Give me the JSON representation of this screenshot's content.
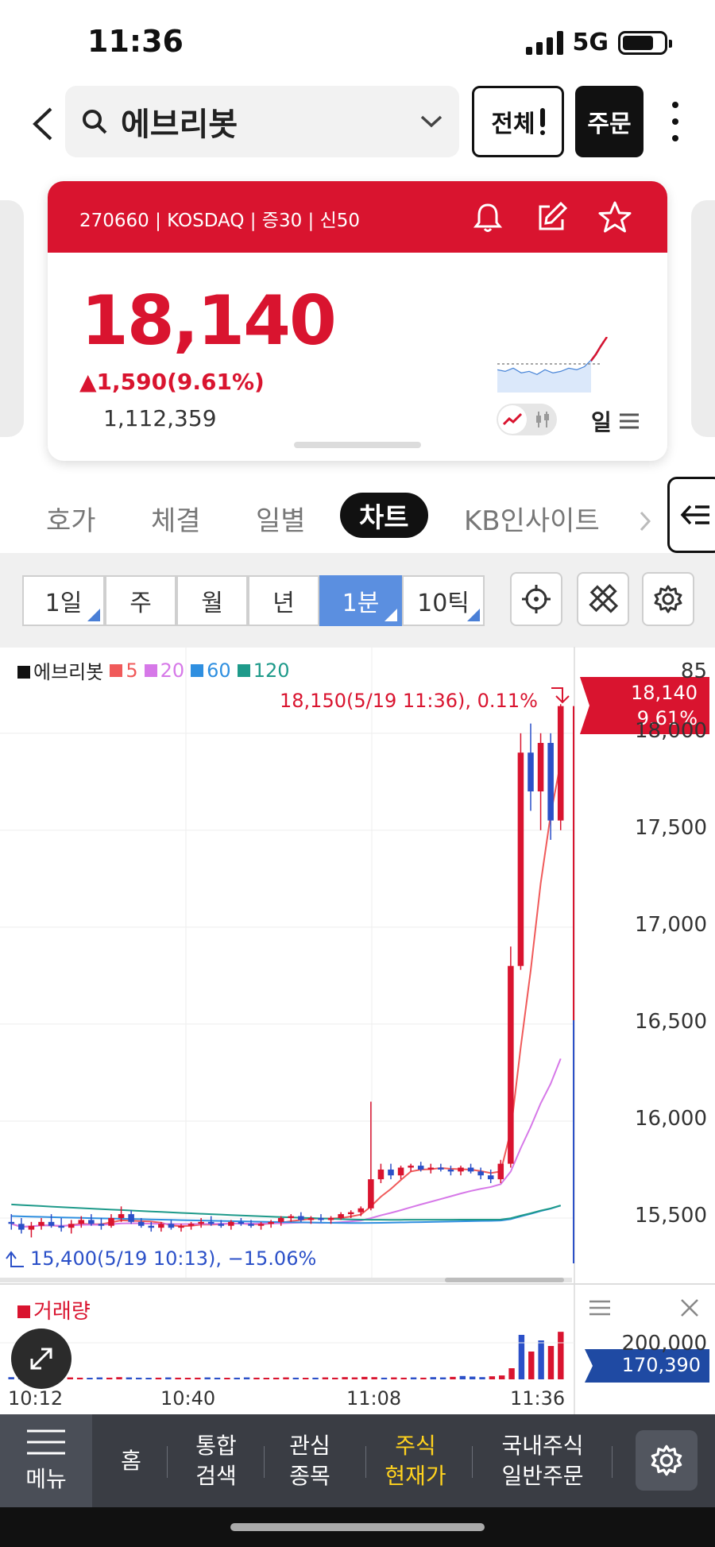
{
  "status": {
    "time": "11:36",
    "network": "5G"
  },
  "header": {
    "search_query": "에브리봇",
    "all_label": "전체",
    "order_label": "주문"
  },
  "card": {
    "info": "270660 | KOSDAQ | 증30 | 신50",
    "price": "18,140",
    "change": "▲1,590(9.61%)",
    "volume": "1,112,359",
    "period_label": "일"
  },
  "tabs": [
    "호가",
    "체결",
    "일별",
    "차트",
    "KB인사이트"
  ],
  "active_tab": "차트",
  "periods": [
    "1일",
    "주",
    "월",
    "년",
    "1분",
    "10틱"
  ],
  "active_period": "1분",
  "chart_data": {
    "type": "candlestick",
    "legend": [
      {
        "name": "에브리봇",
        "color": "#111111"
      },
      {
        "name": "5",
        "color": "#f05a5a"
      },
      {
        "name": "20",
        "color": "#d678e8"
      },
      {
        "name": "60",
        "color": "#2f8fe0"
      },
      {
        "name": "120",
        "color": "#1e9a8a"
      }
    ],
    "high_annotation": "18,150(5/19 11:36), 0.11%",
    "low_annotation": "15,400(5/19 10:13), −15.06%",
    "current_price": "18,140",
    "current_pct": "9.61%",
    "y_top_clipped": "85",
    "y_ticks": [
      "18,000",
      "17,500",
      "17,000",
      "16,500",
      "16,000",
      "15,500"
    ],
    "y_values": [
      18000,
      17500,
      17000,
      16500,
      16000,
      15500
    ],
    "ylim": [
      15250,
      18200
    ],
    "x_ticks": [
      "10:12",
      "10:40",
      "11:08",
      "11:36"
    ],
    "price_series": [
      {
        "o": 15480,
        "h": 15520,
        "l": 15440,
        "c": 15470
      },
      {
        "o": 15470,
        "h": 15500,
        "l": 15420,
        "c": 15440
      },
      {
        "o": 15440,
        "h": 15480,
        "l": 15400,
        "c": 15460
      },
      {
        "o": 15460,
        "h": 15500,
        "l": 15440,
        "c": 15480
      },
      {
        "o": 15480,
        "h": 15520,
        "l": 15450,
        "c": 15460
      },
      {
        "o": 15460,
        "h": 15500,
        "l": 15430,
        "c": 15450
      },
      {
        "o": 15450,
        "h": 15490,
        "l": 15420,
        "c": 15470
      },
      {
        "o": 15470,
        "h": 15510,
        "l": 15450,
        "c": 15490
      },
      {
        "o": 15490,
        "h": 15520,
        "l": 15460,
        "c": 15470
      },
      {
        "o": 15470,
        "h": 15500,
        "l": 15440,
        "c": 15460
      },
      {
        "o": 15460,
        "h": 15520,
        "l": 15450,
        "c": 15500
      },
      {
        "o": 15500,
        "h": 15560,
        "l": 15480,
        "c": 15520
      },
      {
        "o": 15520,
        "h": 15540,
        "l": 15470,
        "c": 15480
      },
      {
        "o": 15480,
        "h": 15500,
        "l": 15450,
        "c": 15460
      },
      {
        "o": 15460,
        "h": 15480,
        "l": 15430,
        "c": 15450
      },
      {
        "o": 15450,
        "h": 15480,
        "l": 15430,
        "c": 15470
      },
      {
        "o": 15470,
        "h": 15490,
        "l": 15440,
        "c": 15450
      },
      {
        "o": 15450,
        "h": 15470,
        "l": 15430,
        "c": 15460
      },
      {
        "o": 15460,
        "h": 15480,
        "l": 15440,
        "c": 15470
      },
      {
        "o": 15470,
        "h": 15500,
        "l": 15450,
        "c": 15480
      },
      {
        "o": 15480,
        "h": 15510,
        "l": 15460,
        "c": 15470
      },
      {
        "o": 15470,
        "h": 15490,
        "l": 15450,
        "c": 15460
      },
      {
        "o": 15460,
        "h": 15490,
        "l": 15440,
        "c": 15480
      },
      {
        "o": 15480,
        "h": 15500,
        "l": 15460,
        "c": 15470
      },
      {
        "o": 15470,
        "h": 15490,
        "l": 15450,
        "c": 15460
      },
      {
        "o": 15460,
        "h": 15480,
        "l": 15440,
        "c": 15470
      },
      {
        "o": 15470,
        "h": 15490,
        "l": 15450,
        "c": 15480
      },
      {
        "o": 15480,
        "h": 15510,
        "l": 15460,
        "c": 15500
      },
      {
        "o": 15500,
        "h": 15520,
        "l": 15480,
        "c": 15510
      },
      {
        "o": 15510,
        "h": 15530,
        "l": 15480,
        "c": 15490
      },
      {
        "o": 15490,
        "h": 15510,
        "l": 15470,
        "c": 15500
      },
      {
        "o": 15500,
        "h": 15520,
        "l": 15480,
        "c": 15490
      },
      {
        "o": 15490,
        "h": 15510,
        "l": 15470,
        "c": 15500
      },
      {
        "o": 15500,
        "h": 15530,
        "l": 15490,
        "c": 15520
      },
      {
        "o": 15520,
        "h": 15540,
        "l": 15500,
        "c": 15530
      },
      {
        "o": 15530,
        "h": 15560,
        "l": 15510,
        "c": 15550
      },
      {
        "o": 15550,
        "h": 16100,
        "l": 15540,
        "c": 15700
      },
      {
        "o": 15700,
        "h": 15780,
        "l": 15680,
        "c": 15750
      },
      {
        "o": 15750,
        "h": 15780,
        "l": 15700,
        "c": 15720
      },
      {
        "o": 15720,
        "h": 15770,
        "l": 15700,
        "c": 15760
      },
      {
        "o": 15760,
        "h": 15780,
        "l": 15740,
        "c": 15770
      },
      {
        "o": 15770,
        "h": 15790,
        "l": 15740,
        "c": 15750
      },
      {
        "o": 15750,
        "h": 15780,
        "l": 15730,
        "c": 15760
      },
      {
        "o": 15760,
        "h": 15780,
        "l": 15740,
        "c": 15750
      },
      {
        "o": 15750,
        "h": 15770,
        "l": 15720,
        "c": 15740
      },
      {
        "o": 15740,
        "h": 15770,
        "l": 15720,
        "c": 15760
      },
      {
        "o": 15760,
        "h": 15780,
        "l": 15730,
        "c": 15740
      },
      {
        "o": 15740,
        "h": 15760,
        "l": 15700,
        "c": 15720
      },
      {
        "o": 15720,
        "h": 15750,
        "l": 15680,
        "c": 15700
      },
      {
        "o": 15700,
        "h": 15800,
        "l": 15680,
        "c": 15780
      },
      {
        "o": 15780,
        "h": 16900,
        "l": 15760,
        "c": 16800
      },
      {
        "o": 16800,
        "h": 18000,
        "l": 16780,
        "c": 17900
      },
      {
        "o": 17900,
        "h": 18050,
        "l": 17600,
        "c": 17700
      },
      {
        "o": 17700,
        "h": 18000,
        "l": 17500,
        "c": 17950
      },
      {
        "o": 17950,
        "h": 18000,
        "l": 17450,
        "c": 17550
      },
      {
        "o": 17550,
        "h": 18150,
        "l": 17500,
        "c": 18140
      }
    ]
  },
  "volume_panel": {
    "label": "거래량",
    "tick": "200,000",
    "current": "170,390",
    "values": [
      8,
      6,
      7,
      5,
      8,
      6,
      7,
      6,
      5,
      7,
      6,
      8,
      7,
      6,
      5,
      6,
      7,
      6,
      5,
      6,
      7,
      6,
      5,
      6,
      7,
      6,
      5,
      6,
      7,
      6,
      5,
      6,
      7,
      6,
      8,
      7,
      9,
      8,
      6,
      7,
      6,
      7,
      6,
      8,
      7,
      9,
      12,
      10,
      8,
      11,
      14,
      40,
      160,
      100,
      140,
      120,
      171
    ]
  },
  "colors": {
    "up": "#d9142f",
    "down": "#2b50c8",
    "accent": "#d9142f",
    "period_active": "#5b8fe0",
    "nav_highlight": "#ffd21e"
  },
  "bottom_nav": {
    "menu": "메뉴",
    "items": [
      {
        "label": "홈"
      },
      {
        "label": "통합\n검색"
      },
      {
        "label": "관심\n종목"
      },
      {
        "label": "주식\n현재가"
      },
      {
        "label": "국내주식\n일반주문"
      }
    ]
  }
}
